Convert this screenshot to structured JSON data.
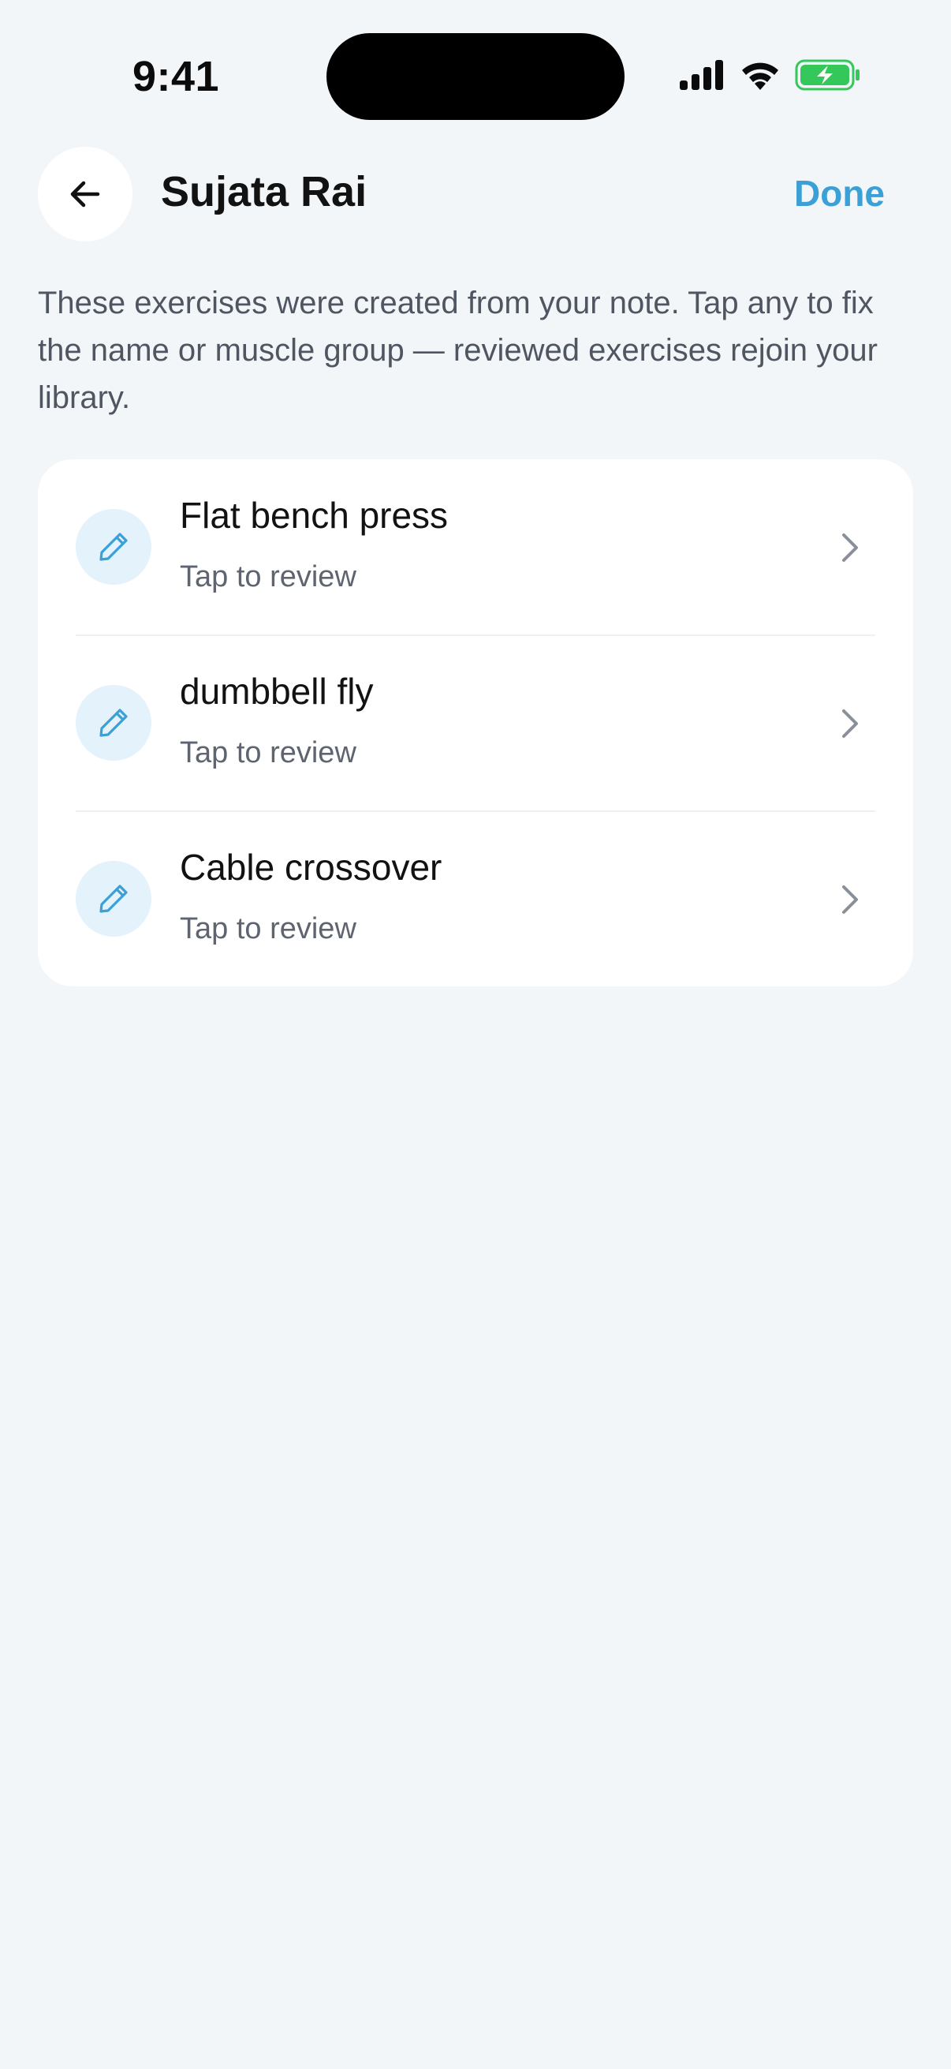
{
  "status_bar": {
    "time": "9:41",
    "icons": [
      "cellular-signal-icon",
      "wifi-icon",
      "battery-charging-icon"
    ],
    "battery_color": "#34c759"
  },
  "header": {
    "back_icon": "arrow-left-icon",
    "title": "Sujata Rai",
    "done_label": "Done"
  },
  "description": "These exercises were created from your note. Tap any to fix the name or muscle group — reviewed exercises rejoin your library.",
  "exercises": [
    {
      "name": "Flat bench press",
      "status": "Tap to review",
      "icon": "pencil-icon"
    },
    {
      "name": "dumbbell fly",
      "status": "Tap to review",
      "icon": "pencil-icon"
    },
    {
      "name": "Cable crossover",
      "status": "Tap to review",
      "icon": "pencil-icon"
    }
  ],
  "colors": {
    "accent": "#3aa0d6",
    "background": "#f2f6f9",
    "icon_circle": "#e4f2fb"
  }
}
